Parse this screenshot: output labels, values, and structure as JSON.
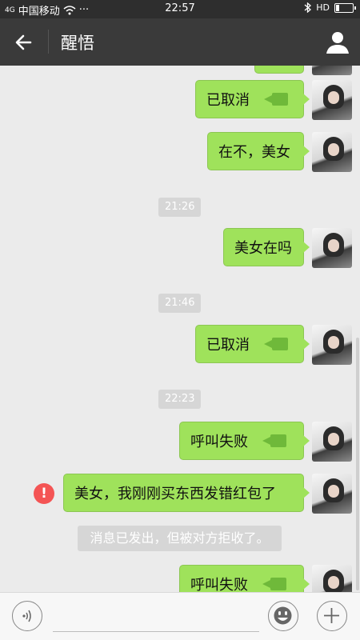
{
  "status_bar": {
    "signal": "4G",
    "carrier": "中国移动",
    "dots": "···",
    "time": "22:57",
    "network": "HD",
    "battery_percent": 20
  },
  "header": {
    "title": "醒悟",
    "back_icon": "arrow-left-icon",
    "profile_icon": "person-icon"
  },
  "messages": [
    {
      "type": "voice_call",
      "text": "已取消"
    },
    {
      "type": "text",
      "text": "在不，美女"
    },
    {
      "type": "time",
      "text": "21:26"
    },
    {
      "type": "text",
      "text": "美女在吗"
    },
    {
      "type": "time",
      "text": "21:46"
    },
    {
      "type": "voice_call",
      "text": "已取消"
    },
    {
      "type": "time",
      "text": "22:23"
    },
    {
      "type": "voice_call",
      "text": "呼叫失败"
    },
    {
      "type": "text_failed",
      "text": "美女，我刚刚买东西发错红包了",
      "error_mark": "!"
    },
    {
      "type": "system",
      "text": "消息已发出，但被对方拒收了。"
    },
    {
      "type": "voice_call",
      "text": "呼叫失败"
    }
  ],
  "input_bar": {
    "voice_icon": "voice-icon",
    "emoji_icon": "emoji-icon",
    "add_icon": "plus-icon"
  },
  "colors": {
    "bubble": "#9fe25b",
    "title_bar": "#3a3a3a",
    "background": "#ebebeb",
    "error": "#f45454"
  }
}
